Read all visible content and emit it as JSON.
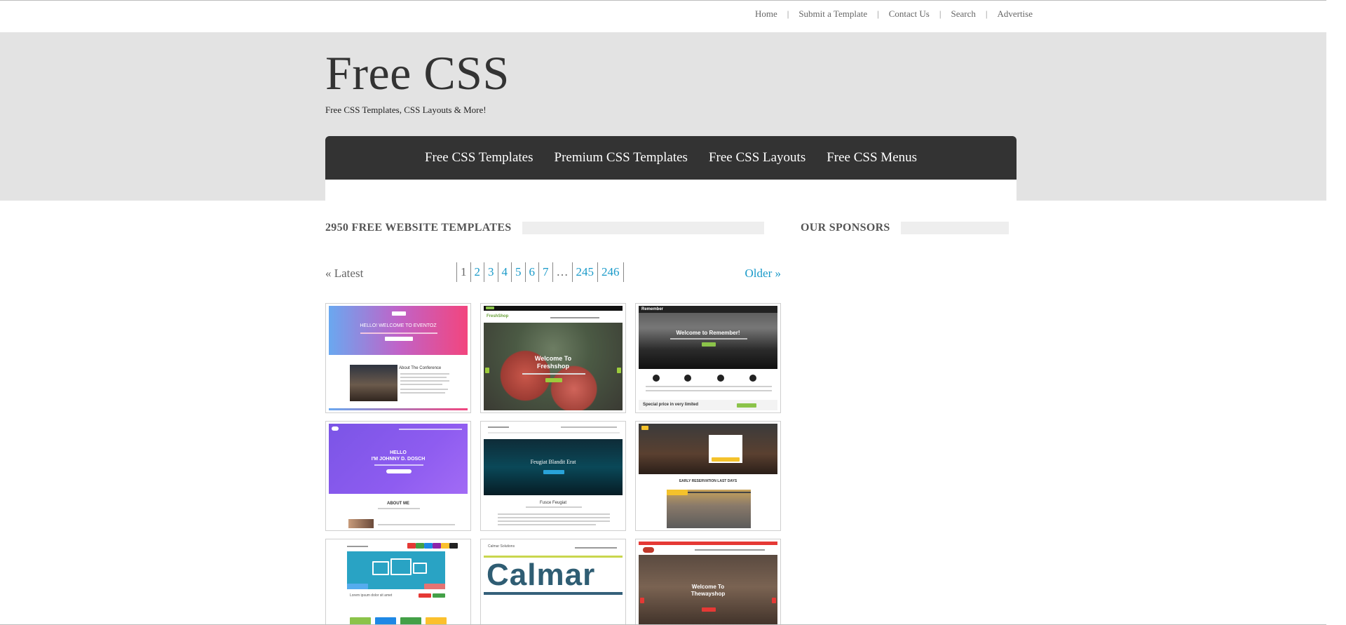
{
  "top_nav": {
    "items": [
      "Home",
      "Submit a Template",
      "Contact Us",
      "Search",
      "Advertise"
    ],
    "separator": "|"
  },
  "header": {
    "title": "Free CSS",
    "tagline": "Free CSS Templates, CSS Layouts & More!"
  },
  "main_nav": {
    "items": [
      "Free CSS Templates",
      "Premium CSS Templates",
      "Free CSS Layouts",
      "Free CSS Menus"
    ]
  },
  "sections": {
    "templates_heading": "2950 FREE WEBSITE TEMPLATES",
    "sponsors_heading": "OUR SPONSORS"
  },
  "pagination": {
    "latest_label": "« Latest",
    "older_label": "Older »",
    "current": "1",
    "pages": [
      "2",
      "3",
      "4",
      "5",
      "6",
      "7"
    ],
    "ellipsis": "…",
    "last_pages": [
      "245",
      "246"
    ]
  },
  "thumbnails": {
    "t1": {
      "hero_line1": "HELLO! WELCOME TO EVENTOZ",
      "about": "About The Conference"
    },
    "t2": {
      "logo": "FreshShop",
      "hero_line1": "Welcome To",
      "hero_line2": "Freshshop"
    },
    "t3": {
      "logo": "Remember",
      "hero_line1": "Welcome to Remember!",
      "promo": "Special price in very limited"
    },
    "t4": {
      "hero_line1": "HELLO",
      "hero_line2": "I'M JOHNNY D. DOSCH",
      "about": "ABOUT ME"
    },
    "t5": {
      "hero_line1": "Feugiat Blandit Erat",
      "features": "Fusce Feugiat"
    },
    "t6": {
      "heading": "EARLY RESERVATION LAST DAYS"
    },
    "t7": {
      "note": "Lorem ipsum dolor sit amet"
    },
    "t8": {
      "logo": "Calmar Solutions",
      "hero_word": "Calmar"
    },
    "t9": {
      "hero_line1": "Welcome To",
      "hero_line2": "Thewayshop"
    }
  },
  "colors": {
    "nav_bg": "#333333",
    "header_band": "#e3e3e3",
    "link_blue": "#1a9ac9"
  }
}
